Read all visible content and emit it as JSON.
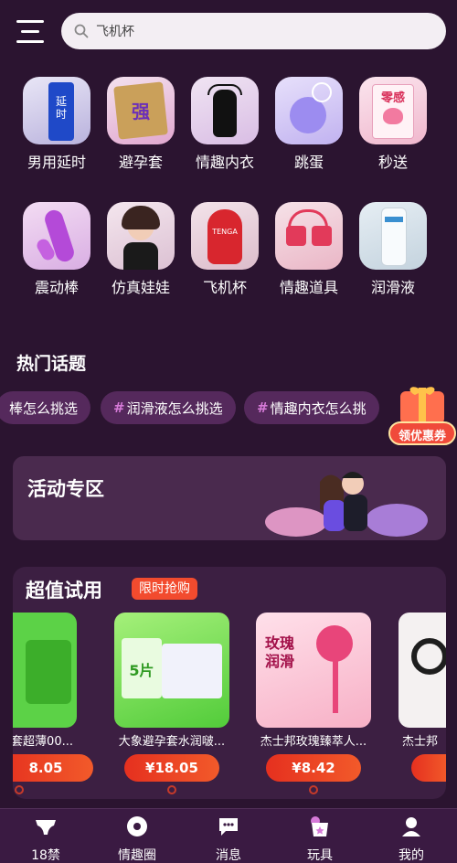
{
  "search": {
    "placeholder": "飞机杯"
  },
  "categories": [
    {
      "label": "男用延时",
      "icon": "delay-spray-icon",
      "thumb_text": "延\n时"
    },
    {
      "label": "避孕套",
      "icon": "condom-box-icon",
      "thumb_text": "强"
    },
    {
      "label": "情趣内衣",
      "icon": "lingerie-icon"
    },
    {
      "label": "跳蛋",
      "icon": "vibrating-egg-icon"
    },
    {
      "label": "秒送",
      "icon": "fast-delivery-box-icon",
      "thumb_text": "零感"
    },
    {
      "label": "震动棒",
      "icon": "vibrator-icon"
    },
    {
      "label": "仿真娃娃",
      "icon": "doll-icon"
    },
    {
      "label": "飞机杯",
      "icon": "masturbator-cup-icon",
      "thumb_text": "TENGA"
    },
    {
      "label": "情趣道具",
      "icon": "restraints-icon"
    },
    {
      "label": "润滑液",
      "icon": "lubricant-bottle-icon"
    }
  ],
  "hot_topics": {
    "title": "热门话题",
    "items": [
      {
        "text": "棒怎么挑选",
        "has_hash": false
      },
      {
        "text": "润滑液怎么挑选",
        "has_hash": true
      },
      {
        "text": "情趣内衣怎么挑",
        "has_hash": true
      }
    ],
    "coupon_label": "领优惠券"
  },
  "activity": {
    "title": "活动专区"
  },
  "trial": {
    "title": "超值试用",
    "badge": "限时抢购",
    "products": [
      {
        "name": "套超薄00...",
        "price": "8.05"
      },
      {
        "name": "大象避孕套水润啵...",
        "price": "¥18.05",
        "box_text": "5片"
      },
      {
        "name": "杰士邦玫瑰臻萃人...",
        "price": "¥8.42",
        "box_text": "玫瑰\n润滑"
      },
      {
        "name": "杰士邦",
        "price": ""
      }
    ]
  },
  "tabbar": {
    "items": [
      {
        "label": "18禁",
        "icon": "underwear-icon"
      },
      {
        "label": "情趣圈",
        "icon": "community-icon"
      },
      {
        "label": "消息",
        "icon": "message-icon"
      },
      {
        "label": "玩具",
        "icon": "toy-bag-icon",
        "active": true
      },
      {
        "label": "我的",
        "icon": "profile-icon"
      }
    ]
  },
  "colors": {
    "background": "#2b1430",
    "topic_chip": "#55295c",
    "price_red": "#e5301f",
    "accent_pink": "#d67ad8"
  }
}
